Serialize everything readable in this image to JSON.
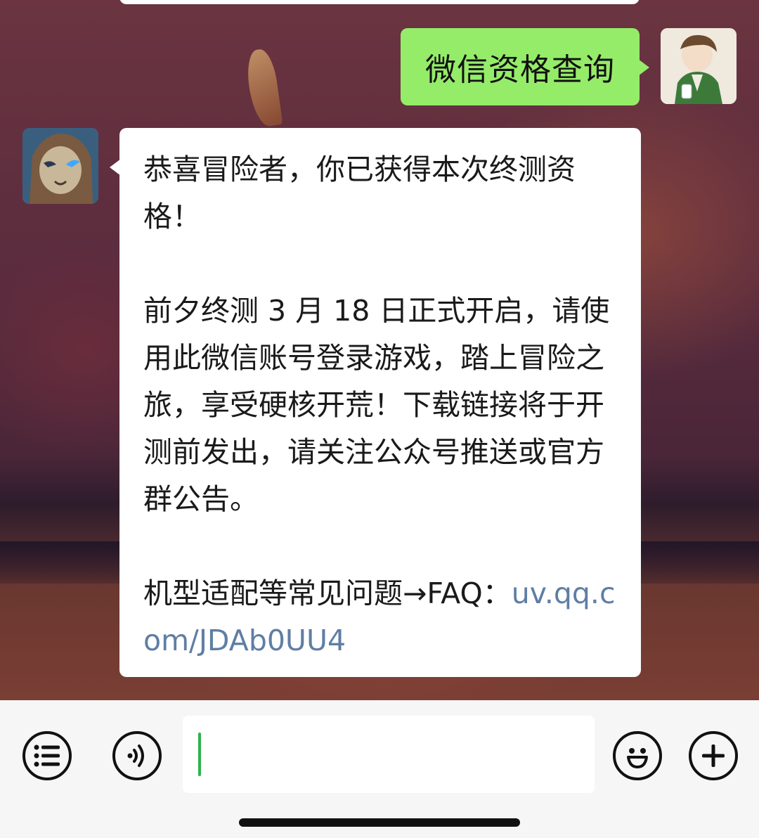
{
  "chat": {
    "outgoing_message": "微信资格查询",
    "incoming_message": {
      "para1": "恭喜冒险者，你已获得本次终测资格！",
      "para2": "前夕终测 3 月 18 日正式开启，请使用此微信账号登录游戏，踏上冒险之旅，享受硬核开荒！下载链接将于开测前发出，请关注公众号推送或官方群公告。",
      "faq_prefix": "机型适配等常见问题→FAQ：",
      "faq_link": "uv.qq.com/JDAb0UU4"
    }
  },
  "input_bar": {
    "menu_icon": "menu-list-icon",
    "voice_icon": "voice-icon",
    "emoji_icon": "emoji-icon",
    "plus_icon": "plus-icon",
    "input_value": ""
  },
  "colors": {
    "outgoing_bubble": "#95ec69",
    "incoming_bubble": "#ffffff",
    "link": "#5f7ea4",
    "caret": "#2fb24c"
  }
}
